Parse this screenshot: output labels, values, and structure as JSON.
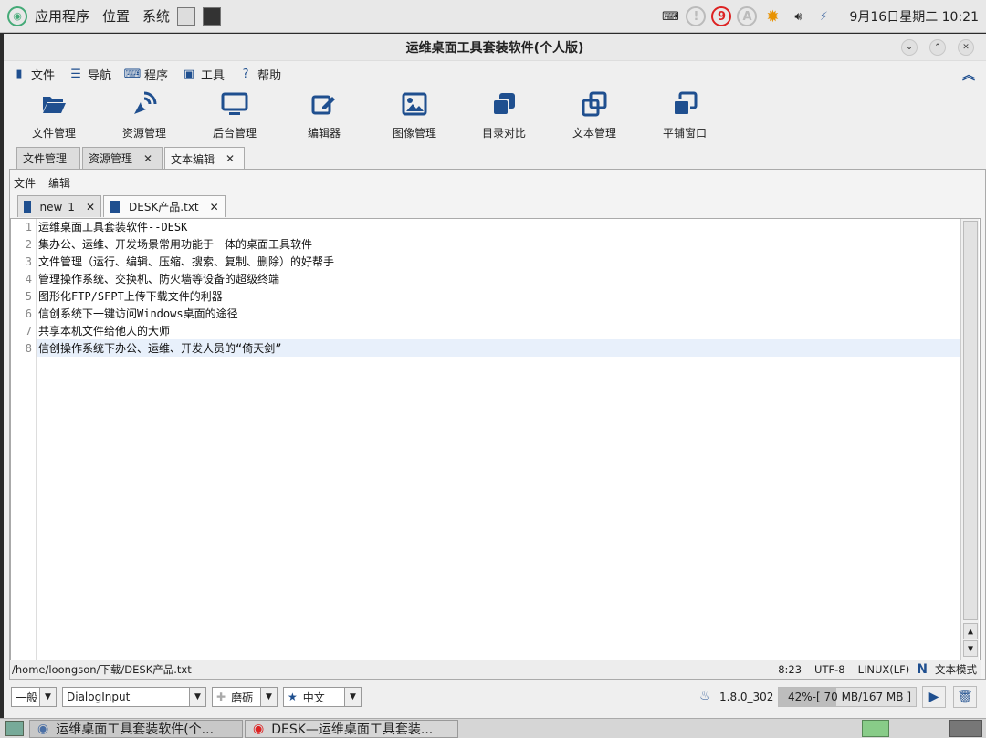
{
  "topbar": {
    "apps_label": "应用程序",
    "places_label": "位置",
    "system_label": "系统",
    "notification_count": "9",
    "clock": "9月16日星期二 10:21"
  },
  "window": {
    "title": "运维桌面工具套装软件(个人版)"
  },
  "menu": [
    {
      "label": "文件",
      "icon": "file-icon"
    },
    {
      "label": "导航",
      "icon": "list-icon"
    },
    {
      "label": "程序",
      "icon": "keyboard-icon"
    },
    {
      "label": "工具",
      "icon": "toolbox-icon"
    },
    {
      "label": "帮助",
      "icon": "help-icon"
    }
  ],
  "toolbar": [
    {
      "label": "文件管理",
      "icon": "folder-open-icon"
    },
    {
      "label": "资源管理",
      "icon": "satellite-dish-icon"
    },
    {
      "label": "后台管理",
      "icon": "monitor-icon"
    },
    {
      "label": "编辑器",
      "icon": "edit-icon"
    },
    {
      "label": "图像管理",
      "icon": "image-icon"
    },
    {
      "label": "目录对比",
      "icon": "stacked-squares-icon"
    },
    {
      "label": "文本管理",
      "icon": "copy-icon"
    },
    {
      "label": "平铺窗口",
      "icon": "windows-icon"
    }
  ],
  "outer_tabs": [
    {
      "label": "文件管理",
      "closable": false
    },
    {
      "label": "资源管理",
      "closable": true
    },
    {
      "label": "文本编辑",
      "closable": true,
      "active": true
    }
  ],
  "sub_menu": [
    "文件",
    "编辑"
  ],
  "inner_tabs": [
    {
      "label": "new_1"
    },
    {
      "label": "DESK产品.txt",
      "active": true
    }
  ],
  "editor": {
    "line_numbers": [
      "1",
      "2",
      "3",
      "4",
      "5",
      "6",
      "7",
      "8"
    ],
    "lines": [
      "运维桌面工具套装软件--DESK",
      "集办公、运维、开发场景常用功能于一体的桌面工具软件",
      "文件管理（运行、编辑、压缩、搜索、复制、删除）的好帮手",
      "管理操作系统、交换机、防火墙等设备的超级终端",
      "图形化FTP/SFPT上传下载文件的利器",
      "信创系统下一键访问Windows桌面的途径",
      "共享本机文件给他人的大师",
      "信创操作系统下办公、运维、开发人员的“倚天剑”"
    ]
  },
  "status": {
    "path": "/home/loongson/下载/DESK产品.txt",
    "cursor": "8:23",
    "encoding": "UTF-8",
    "eol": "LINUX(LF)",
    "mode": "文本模式"
  },
  "bottom": {
    "level": "一般",
    "font": "DialogInput",
    "theme": "磨砺",
    "lang": "中文",
    "version": "1.8.0_302",
    "memory_text": "42%-[ 70 MB/167 MB ]",
    "memory_fraction": 0.42
  },
  "taskbar": [
    {
      "label": "运维桌面工具套装软件(个..."
    },
    {
      "label": "DESK—运维桌面工具套装..."
    }
  ],
  "colors": {
    "accent": "#1f4f8f",
    "notify": "#dd2222"
  }
}
